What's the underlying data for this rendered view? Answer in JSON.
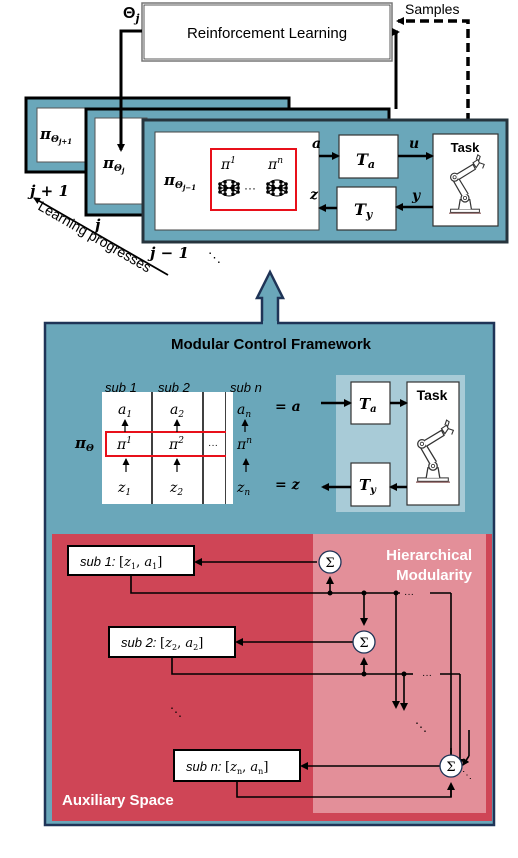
{
  "colors": {
    "teal": "#6aa7ba",
    "teal_light": "#a8cbd7",
    "navy": "#1f3457",
    "red": "#cf4556",
    "pink": "#e38f99",
    "policy_box_border": "#e8101a",
    "black": "#000000",
    "white": "#ffffff"
  },
  "top": {
    "rl_box_label": "Reinforcement Learning",
    "theta_label": "Θ",
    "theta_sub": "j",
    "samples_label": "Samples",
    "frames": [
      {
        "policy": "π",
        "policy_sub": "Θ",
        "policy_subsub": "j+1",
        "index_label": "j + 1"
      },
      {
        "policy": "π",
        "policy_sub": "Θ",
        "policy_subsub": "j",
        "index_label": "j"
      },
      {
        "policy": "π",
        "policy_sub": "Θ",
        "policy_subsub": "j−1",
        "index_label": "j − 1"
      }
    ],
    "more_frames": "⋱",
    "learning_label": "Learning progresses",
    "inner": {
      "pi_first": "π",
      "pi_first_sup": "1",
      "pi_last": "π",
      "pi_last_sup": "n",
      "ellipsis": "···",
      "signal_a": "a",
      "signal_u": "u",
      "signal_z": "z",
      "signal_y": "y",
      "ta_label": "T",
      "ta_sub": "a",
      "ty_label": "T",
      "ty_sub": "y",
      "task_label": "Task"
    }
  },
  "framework": {
    "title": "Modular Control Framework",
    "columns": [
      {
        "header": "sub 1",
        "out": "a",
        "out_sub": "1",
        "pi_sup": "1",
        "in": "z",
        "in_sub": "1"
      },
      {
        "header": "sub 2",
        "out": "a",
        "out_sub": "2",
        "pi_sup": "2",
        "in": "z",
        "in_sub": "2"
      },
      {
        "header": "",
        "out": "",
        "out_sub": "",
        "pi_sup": "",
        "in": "",
        "in_sub": "",
        "dots": "···"
      },
      {
        "header": "sub n",
        "out": "a",
        "out_sub": "n",
        "pi_sup": "n",
        "in": "z",
        "in_sub": "n"
      }
    ],
    "pi_theta": "π",
    "pi_theta_sub": "Θ",
    "pi_symbol": "π",
    "eq_a": "= a",
    "eq_z": "= z",
    "ta_label": "T",
    "ta_sub": "a",
    "ty_label": "T",
    "ty_sub": "y",
    "task_label": "Task"
  },
  "auxiliary": {
    "title": "Auxiliary Space",
    "hier_title_1": "Hierarchical",
    "hier_title_2": "Modularity",
    "subs": [
      {
        "prefix": "sub 1: ",
        "z": "z",
        "zs": "1",
        "a": "a",
        "as": "1"
      },
      {
        "prefix": "sub 2: ",
        "z": "z",
        "zs": "2",
        "a": "a",
        "as": "2"
      },
      {
        "prefix": "sub n: ",
        "z": "z",
        "zs": "n",
        "a": "a",
        "as": "n"
      }
    ],
    "sum_symbol": "Σ",
    "ellipsis_h": "···",
    "ellipsis_d": "⋱"
  }
}
